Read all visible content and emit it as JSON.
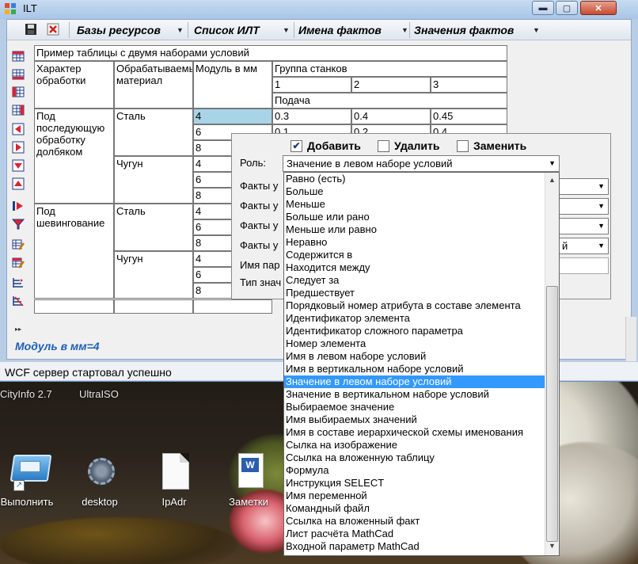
{
  "window": {
    "title": "ILT",
    "min_glyph": "▬",
    "max_glyph": "▢",
    "close_glyph": "✕"
  },
  "toolbar": {
    "dropdowns": [
      "Базы ресурсов",
      "Список ИЛТ",
      "Имена фактов",
      "Значения фактов"
    ]
  },
  "table": {
    "caption": "Пример таблицы с двумя наборами условий",
    "headers": {
      "processing": "Характер обработки",
      "material": "Обрабатываемый материал",
      "module": "Модуль в мм",
      "machine_group": "Группа станков",
      "feed": "Подача"
    },
    "machine_groups": [
      "1",
      "2",
      "3"
    ],
    "feed_row1": [
      "0.3",
      "0.4",
      "0.45"
    ],
    "feed_row2": [
      "0.1",
      "0.2",
      "0.4"
    ],
    "processing": [
      "Под последующую обработку долбяком",
      "Под шевингование"
    ],
    "materials": [
      "Сталь",
      "Чугун",
      "Сталь",
      "Чугун"
    ],
    "modules": [
      "4",
      "6",
      "8",
      "4",
      "6",
      "8",
      "4",
      "6",
      "8",
      "4",
      "6",
      "8"
    ]
  },
  "panel": {
    "add_label": "Добавить",
    "add_checked": true,
    "delete_label": "Удалить",
    "replace_label": "Заменить",
    "role_label": "Роль:",
    "role_value": "Значение в левом наборе условий",
    "fact_labels": [
      "Факты у",
      "Факты у",
      "Факты у",
      "Факты у"
    ],
    "param_label": "Имя пар",
    "type_label": "Тип знач",
    "fact4_value": "й"
  },
  "dropdown": {
    "items": [
      "Равно (есть)",
      "Больше",
      "Меньше",
      "Больше или рано",
      "Меньше или равно",
      "Неравно",
      "Содержится в",
      "Находится между",
      "Следует за",
      "Предшествует",
      "Порядковый номер атрибута в составе элемента",
      "Идентификатор элемента",
      "Идентификатор сложного параметра",
      "Номер элемента",
      "Имя в левом наборе условий",
      "Имя в вертикальном наборе условий",
      "Значение в левом наборе условий",
      "Значение в вертикальном наборе условий",
      "Выбираемое значение",
      "Имя выбираемых значений",
      "Имя в составе иерархической схемы именования",
      "Сылка на изображение",
      "Ссылка на вложенную таблицу",
      "Формула",
      "Инструкция SELECT",
      "Имя переменной",
      "Командный файл",
      "Ссылка на вложенный факт",
      "Лист расчёта MathCad",
      "Входной параметр MathCad"
    ],
    "highlighted_index": 16
  },
  "status": {
    "fact_line": "Модуль в мм=4",
    "message": "WCF сервер стартовал успешно"
  },
  "desktop": {
    "top_programs": [
      "CityInfo 2.7",
      "UltraISO"
    ],
    "icons": [
      "Выполнить",
      "desktop",
      "IpAdr",
      "Заметки"
    ]
  }
}
